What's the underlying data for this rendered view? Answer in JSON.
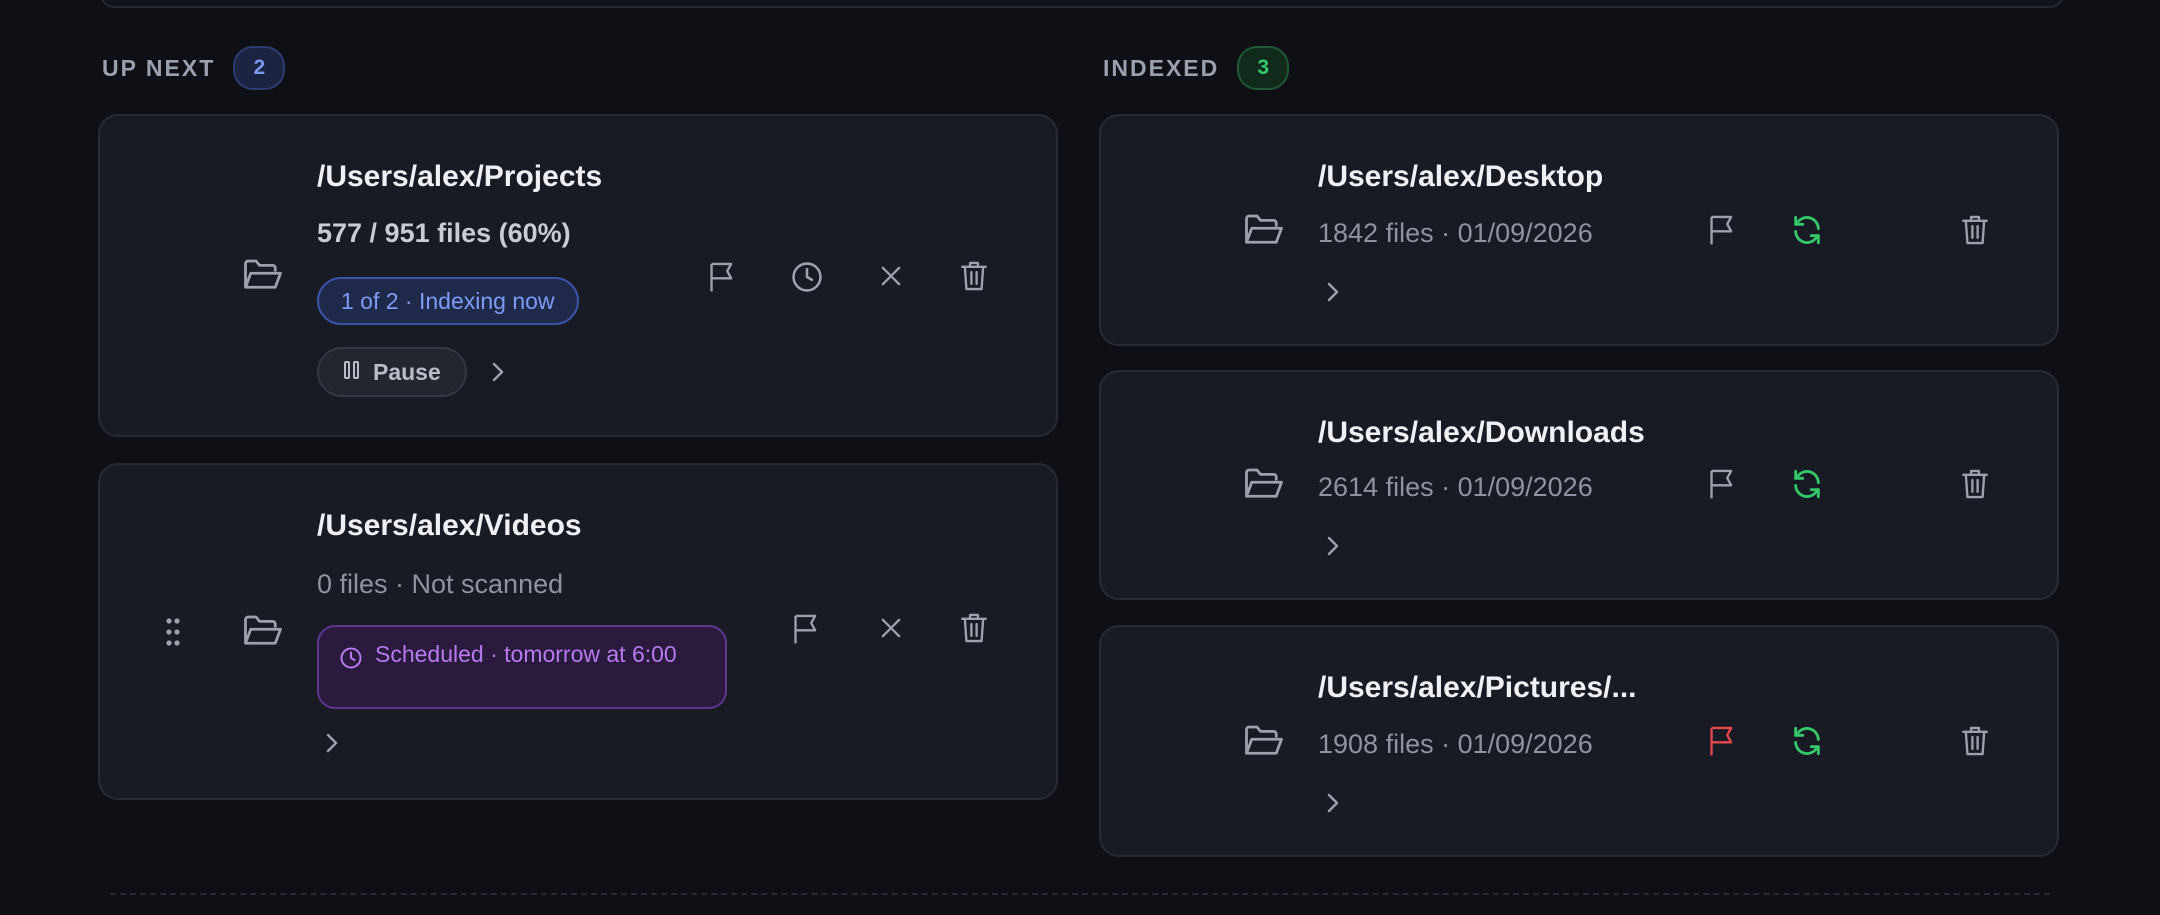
{
  "up_next": {
    "title": "UP NEXT",
    "count": "2",
    "items": [
      {
        "path": "/Users/alex/Projects",
        "progress_text": "577 / 951 files (60%)",
        "status_pill": "1 of 2 · Indexing now",
        "pause_label": "Pause"
      },
      {
        "path": "/Users/alex/Videos",
        "meta": "0 files · Not scanned",
        "scheduled": "Scheduled · tomorrow at 6:00"
      }
    ]
  },
  "indexed": {
    "title": "INDEXED",
    "count": "3",
    "items": [
      {
        "path": "/Users/alex/Desktop",
        "meta": "1842 files · 01/09/2026",
        "flagged": false
      },
      {
        "path": "/Users/alex/Downloads",
        "meta": "2614 files · 01/09/2026",
        "flagged": false
      },
      {
        "path": "/Users/alex/Pictures/...",
        "meta": "1908 files · 01/09/2026",
        "flagged": true
      }
    ]
  },
  "colors": {
    "background": "#0e1016",
    "card": "#181b23",
    "accent_blue": "#7b97f0",
    "accent_green": "#35c76a",
    "accent_purple": "#b779f0",
    "flag_red": "#e5484d"
  },
  "icons": {
    "folder": "folder-open-icon",
    "flag": "flag-icon",
    "clock": "clock-icon",
    "close": "close-icon",
    "trash": "trash-icon",
    "refresh": "refresh-icon",
    "chevron": "chevron-right-icon",
    "drag": "drag-handle-icon",
    "pause": "pause-icon"
  }
}
